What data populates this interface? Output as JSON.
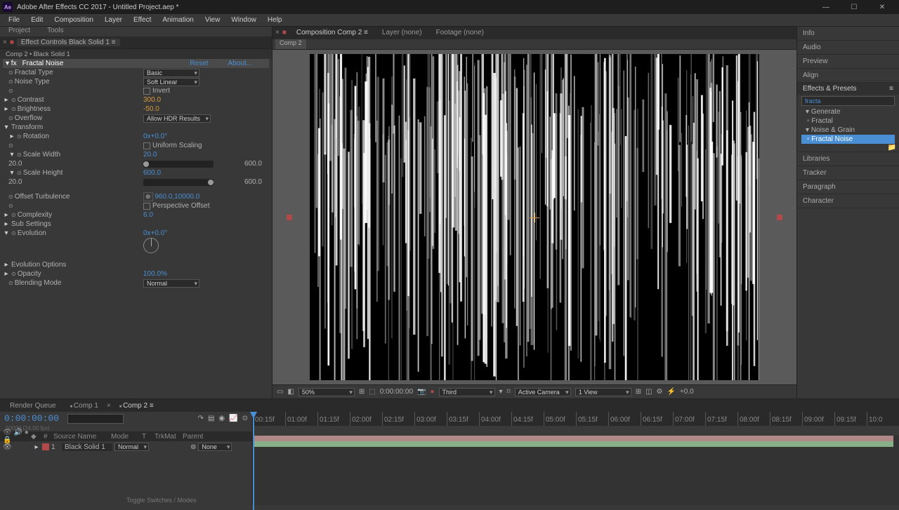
{
  "titlebar": {
    "text": "Adobe After Effects CC 2017 - Untitled Project.aep *"
  },
  "menu": {
    "items": [
      "File",
      "Edit",
      "Composition",
      "Layer",
      "Effect",
      "Animation",
      "View",
      "Window",
      "Help"
    ]
  },
  "left_tabs": {
    "project": "Project",
    "tools": "Tools"
  },
  "effect_panel": {
    "tab": "Effect Controls Black Solid 1",
    "breadcrumb": "Comp 2 • Black Solid 1",
    "fx_name": "Fractal Noise",
    "reset": "Reset",
    "about": "About...",
    "rows": {
      "fractal_type_l": "Fractal Type",
      "fractal_type_v": "Basic",
      "noise_type_l": "Noise Type",
      "noise_type_v": "Soft Linear",
      "invert_l": "Invert",
      "contrast_l": "Contrast",
      "contrast_v": "300.0",
      "brightness_l": "Brightness",
      "brightness_v": "-50.0",
      "overflow_l": "Overflow",
      "overflow_v": "Allow HDR Results",
      "transform_l": "Transform",
      "rotation_l": "Rotation",
      "rotation_v": "0x+0.0°",
      "uniform_l": "Uniform Scaling",
      "scale_w_l": "Scale Width",
      "scale_w_v": "20.0",
      "scale_w_min": "20.0",
      "scale_w_max": "600.0",
      "scale_h_l": "Scale Height",
      "scale_h_v": "600.0",
      "scale_h_min": "20.0",
      "scale_h_max": "600.0",
      "offset_l": "Offset Turbulence",
      "offset_v": "960.0,10000.0",
      "perspective_l": "Perspective Offset",
      "complexity_l": "Complexity",
      "complexity_v": "6.0",
      "sub_l": "Sub Settings",
      "evolution_l": "Evolution",
      "evolution_v": "0x+0.0°",
      "evo_opts_l": "Evolution Options",
      "opacity_l": "Opacity",
      "opacity_v": "100.0%",
      "blend_l": "Blending Mode",
      "blend_v": "Normal"
    }
  },
  "viewer": {
    "tabs": {
      "comp": "Composition Comp 2",
      "layer": "Layer (none)",
      "footage": "Footage (none)"
    },
    "comp_tab": "Comp 2",
    "controls": {
      "zoom": "50%",
      "timecode": "0:00:00:00",
      "quality": "Third",
      "camera": "Active Camera",
      "views": "1 View",
      "exposure": "+0.0"
    }
  },
  "right": {
    "items": [
      "Info",
      "Audio",
      "Preview",
      "Align"
    ],
    "effects_presets": "Effects & Presets",
    "search": "fracta",
    "tree": {
      "generate": "Generate",
      "fractal": "Fractal",
      "noise_grain": "Noise & Grain",
      "fractal_noise": "Fractal Noise"
    },
    "items2": [
      "Libraries",
      "Tracker",
      "Paragraph",
      "Character"
    ]
  },
  "timeline": {
    "tabs": {
      "rq": "Render Queue",
      "c1": "Comp 1",
      "c2": "Comp 2"
    },
    "timecode": "0:00:00:00",
    "sub": "00000 (24.00 fps)",
    "search_ph": "",
    "cols": {
      "num": "#",
      "src": "Source Name",
      "mode": "Mode",
      "t": "T",
      "trk": "TrkMat",
      "parent": "Parent"
    },
    "layer": {
      "num": "1",
      "name": "Black Solid 1",
      "mode": "Normal",
      "parent": "None"
    },
    "ruler": [
      "00:15f",
      "01:00f",
      "01:15f",
      "02:00f",
      "02:15f",
      "03:00f",
      "03:15f",
      "04:00f",
      "04:15f",
      "05:00f",
      "05:15f",
      "06:00f",
      "06:15f",
      "07:00f",
      "07:15f",
      "08:00f",
      "08:15f",
      "09:00f",
      "09:15f",
      "10:0"
    ],
    "toggle": "Toggle Switches / Modes"
  }
}
